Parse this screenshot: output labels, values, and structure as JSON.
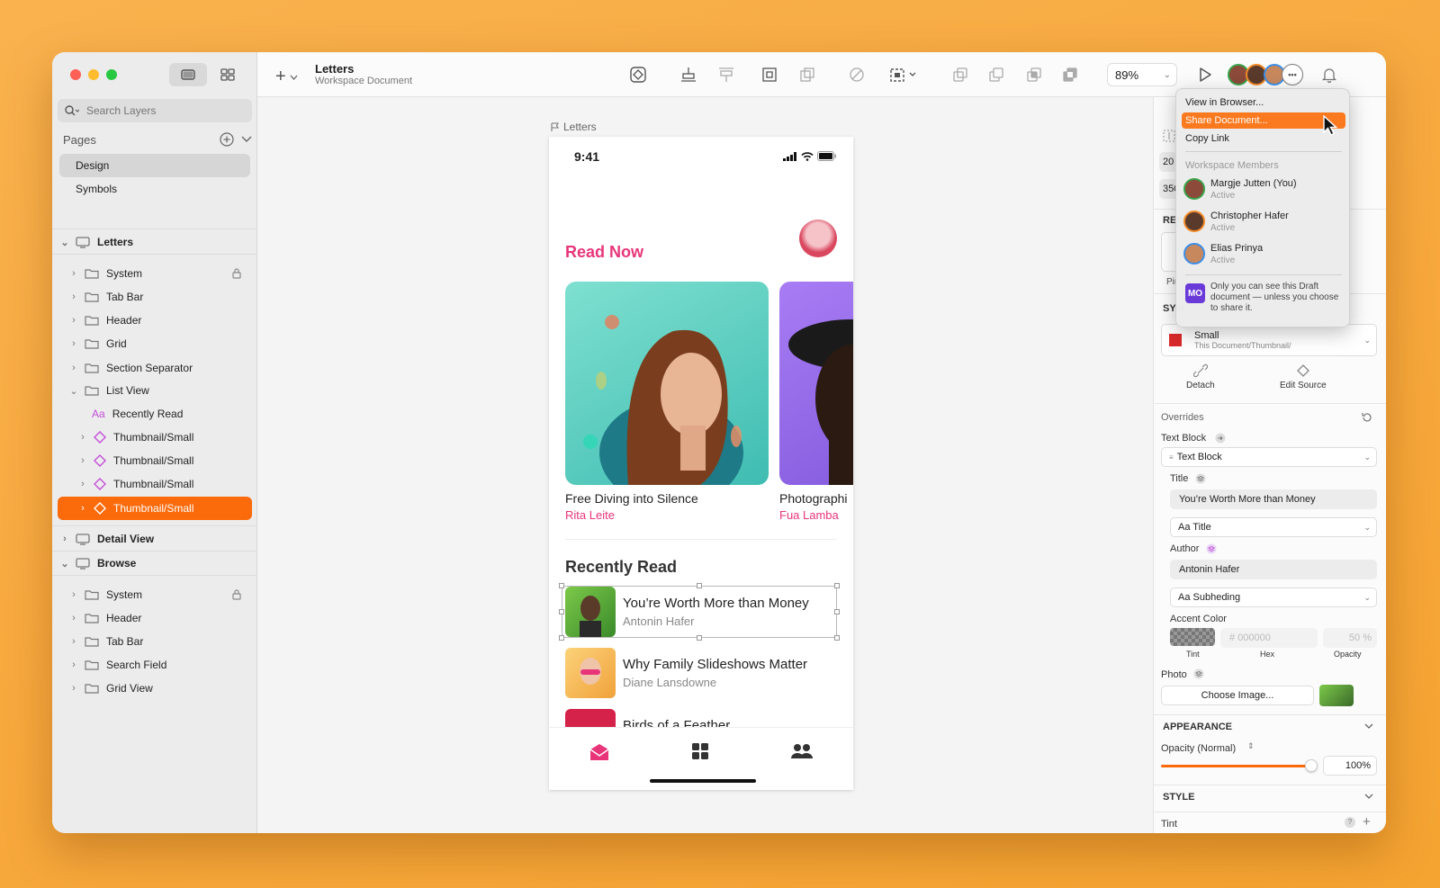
{
  "sidebar": {
    "search_placeholder": "Search Layers",
    "pages_label": "Pages",
    "pages": [
      {
        "label": "Design"
      },
      {
        "label": "Symbols"
      }
    ],
    "layers": [
      {
        "label": "Letters"
      },
      {
        "label": "System"
      },
      {
        "label": "Tab Bar"
      },
      {
        "label": "Header"
      },
      {
        "label": "Grid"
      },
      {
        "label": "Section Separator"
      },
      {
        "label": "List View"
      },
      {
        "label": "Recently Read"
      },
      {
        "label": "Thumbnail/Small"
      },
      {
        "label": "Thumbnail/Small"
      },
      {
        "label": "Thumbnail/Small"
      },
      {
        "label": "Thumbnail/Small"
      },
      {
        "label": "Detail View"
      },
      {
        "label": "Browse"
      },
      {
        "label": "System"
      },
      {
        "label": "Header"
      },
      {
        "label": "Tab Bar"
      },
      {
        "label": "Search Field"
      },
      {
        "label": "Grid View"
      }
    ],
    "text_glyph": "Aa"
  },
  "toolbar": {
    "doc_title": "Letters",
    "doc_subtitle": "Workspace Document",
    "zoom": "89%"
  },
  "canvas": {
    "artboard_label": "Letters",
    "status_time": "9:41",
    "read_now": "Read Now",
    "cards": [
      {
        "title": "Free Diving into Silence",
        "author": "Rita Leite"
      },
      {
        "title": "Photographi",
        "author": "Fua Lamba"
      }
    ],
    "recently_read": "Recently Read",
    "rows": [
      {
        "title": "You’re Worth More than Money",
        "author": "Antonin Hafer"
      },
      {
        "title": "Why Family Slideshows Matter",
        "author": "Diane Lansdowne"
      },
      {
        "title": "Birds of a Feather",
        "author": ""
      }
    ]
  },
  "inspector": {
    "field_20": "20",
    "field_350": "350",
    "resize_label": "RESI",
    "pin_label": "Pin",
    "symbol_label": "SYM",
    "symbol_name": "Small",
    "symbol_path": "This Document/Thumbnail/",
    "detach": "Detach",
    "edit_source": "Edit Source",
    "overrides": "Overrides",
    "text_block_label": "Text Block",
    "text_block_value": "Text Block",
    "title_label": "Title",
    "title_value": "You’re Worth More than Money",
    "title_style": "Aa Title",
    "author_label": "Author",
    "author_value": "Antonin Hafer",
    "author_style": "Aa Subheding",
    "accent_label": "Accent Color",
    "hex_placeholder": "# 000000",
    "opacity_val": "50 %",
    "tint_lbl": "Tint",
    "hex_lbl": "Hex",
    "opacity_lbl": "Opacity",
    "photo_label": "Photo",
    "choose_image": "Choose Image...",
    "appearance": "APPEARANCE",
    "opacity_normal": "Opacity (Normal)",
    "opacity_pct": "100%",
    "style": "STYLE",
    "tint": "Tint"
  },
  "menu": {
    "items": [
      "View in Browser...",
      "Share Document...",
      "Copy Link"
    ],
    "members_header": "Workspace Members",
    "members": [
      {
        "name": "Margje Jutten (You)",
        "status": "Active"
      },
      {
        "name": "Christopher Hafer",
        "status": "Active"
      },
      {
        "name": "Elias Prinya",
        "status": "Active"
      }
    ],
    "badge": "MO",
    "note": "Only you can see this Draft document — unless you choose to share it."
  },
  "colors": {
    "accent": "#fb6a0b",
    "pink": "#e8357a"
  }
}
